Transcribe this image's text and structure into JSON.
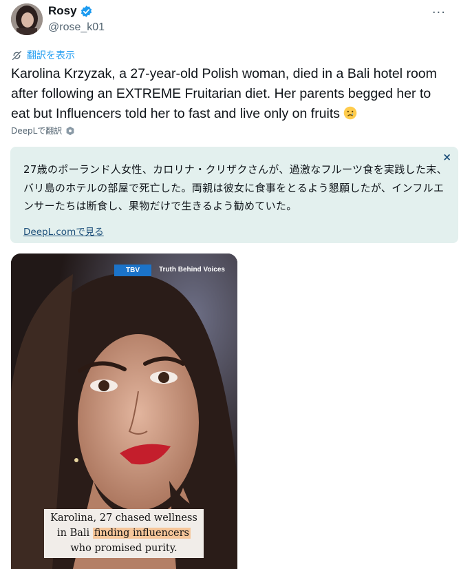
{
  "user": {
    "name": "Rosy",
    "handle": "@rose_k01"
  },
  "actions": {
    "more": "···",
    "translate_label": "翻訳を表示"
  },
  "tweet": {
    "text": "Karolina Krzyzak, a 27-year-old Polish woman, died in a Bali hotel room after following an EXTREME Fruitarian diet. Her parents begged her to eat but Influencers told her to fast and live only on fruits",
    "emoji": "crying-face-emoji"
  },
  "deepl": {
    "label": "DeepLで翻訳"
  },
  "translation": {
    "text": "27歳のポーランド人女性、カロリナ・クリザクさんが、過激なフルーツ食を実践した末、バリ島のホテルの部屋で死亡した。両親は彼女に食事をとるよう懇願したが、インフルエンサーたちは断食し、果物だけで生きるよう勧めていた。",
    "close": "×",
    "link": "DeepL.comで見る"
  },
  "media": {
    "badge": "TBV",
    "badge_sub": "Truth Behind Voices",
    "caption_line1": "Karolina, 27 chased wellness",
    "caption_line2_pre": "in Bali ",
    "caption_line2_hl": "finding influencers",
    "caption_line3": "who promised purity."
  },
  "colors": {
    "accent": "#1d9bf0",
    "translation_bg": "#e3f0ee",
    "badge_blue": "#1b73c9",
    "highlight": "#f6c69a"
  }
}
